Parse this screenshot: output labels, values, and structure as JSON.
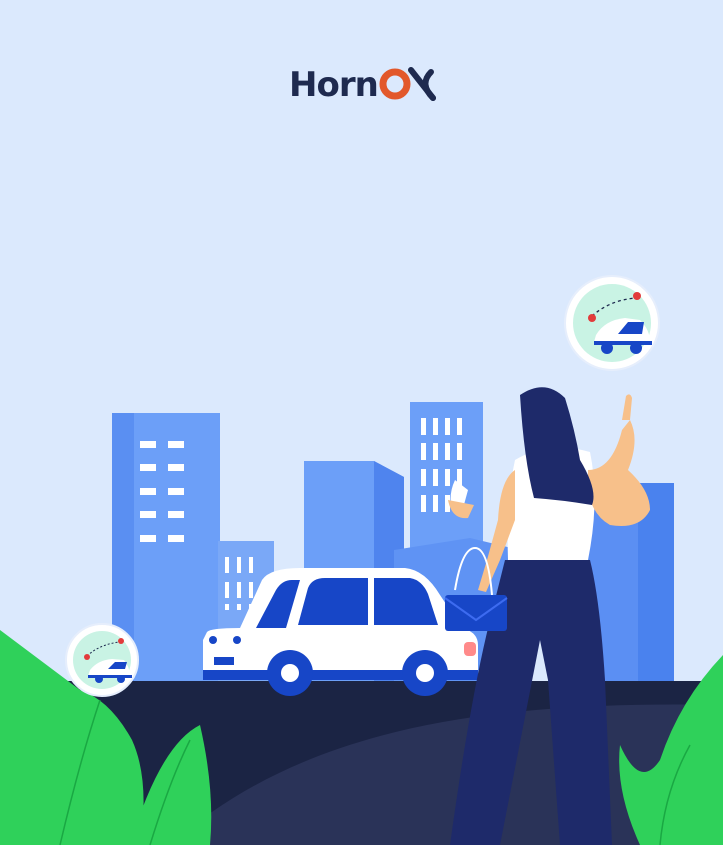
{
  "app": {
    "brand_name": "Horn",
    "brand_mark_letter": "X"
  },
  "colors": {
    "background": "#dbe9fd",
    "brand_dark": "#1e2a4f",
    "brand_accent": "#e2582b",
    "building_light": "#7aa8f7",
    "building_mid": "#5b8ff3",
    "road": "#1b2444",
    "grass": "#2fd15a",
    "car_blue": "#1746c7"
  },
  "icons": {
    "large_badge": "ride-route-icon",
    "small_badge": "ride-route-icon"
  }
}
